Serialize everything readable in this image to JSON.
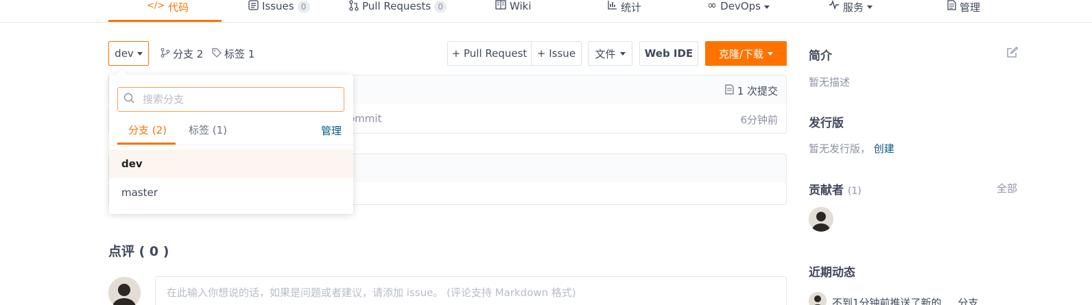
{
  "nav": {
    "code": "代码",
    "issues": "Issues",
    "issues_count": "0",
    "pull_requests": "Pull Requests",
    "pr_count": "0",
    "wiki": "Wiki",
    "stats": "统计",
    "devops": "DevOps",
    "services": "服务",
    "manage": "管理"
  },
  "toolbar": {
    "branch": "dev",
    "branches_label": "分支 2",
    "tags_label": "标签 1",
    "pull_request_btn": "+ Pull Request",
    "issue_btn": "+ Issue",
    "file_btn": "文件",
    "web_ide_btn": "Web IDE",
    "clone_btn": "克隆/下载"
  },
  "files": {
    "commit_count": "1 次提交",
    "commit_message": "ommit",
    "commit_time": "6分钟前"
  },
  "branch_dropdown": {
    "search_placeholder": "搜索分支",
    "tab_branches": "分支 (2)",
    "tab_tags": "标签 (1)",
    "manage": "管理",
    "items": [
      "dev",
      "master"
    ]
  },
  "review": {
    "title": "点评 ( 0 )",
    "placeholder": "在此输入你想说的话，如果是问题或者建议，请添加 issue。 (评论支持 Markdown 格式)"
  },
  "sidebar": {
    "intro_title": "简介",
    "intro_text": "暂无描述",
    "release_title": "发行版",
    "release_text": "暂无发行版，",
    "release_create": "创建",
    "contributors_title": "贡献者",
    "contributors_count": "(1)",
    "contributors_all": "全部",
    "activity_title": "近期动态",
    "activity_text": "不到1分钟前推送了新的 ... 分支"
  },
  "colors": {
    "accent": "#fe7300",
    "link": "#005980"
  }
}
